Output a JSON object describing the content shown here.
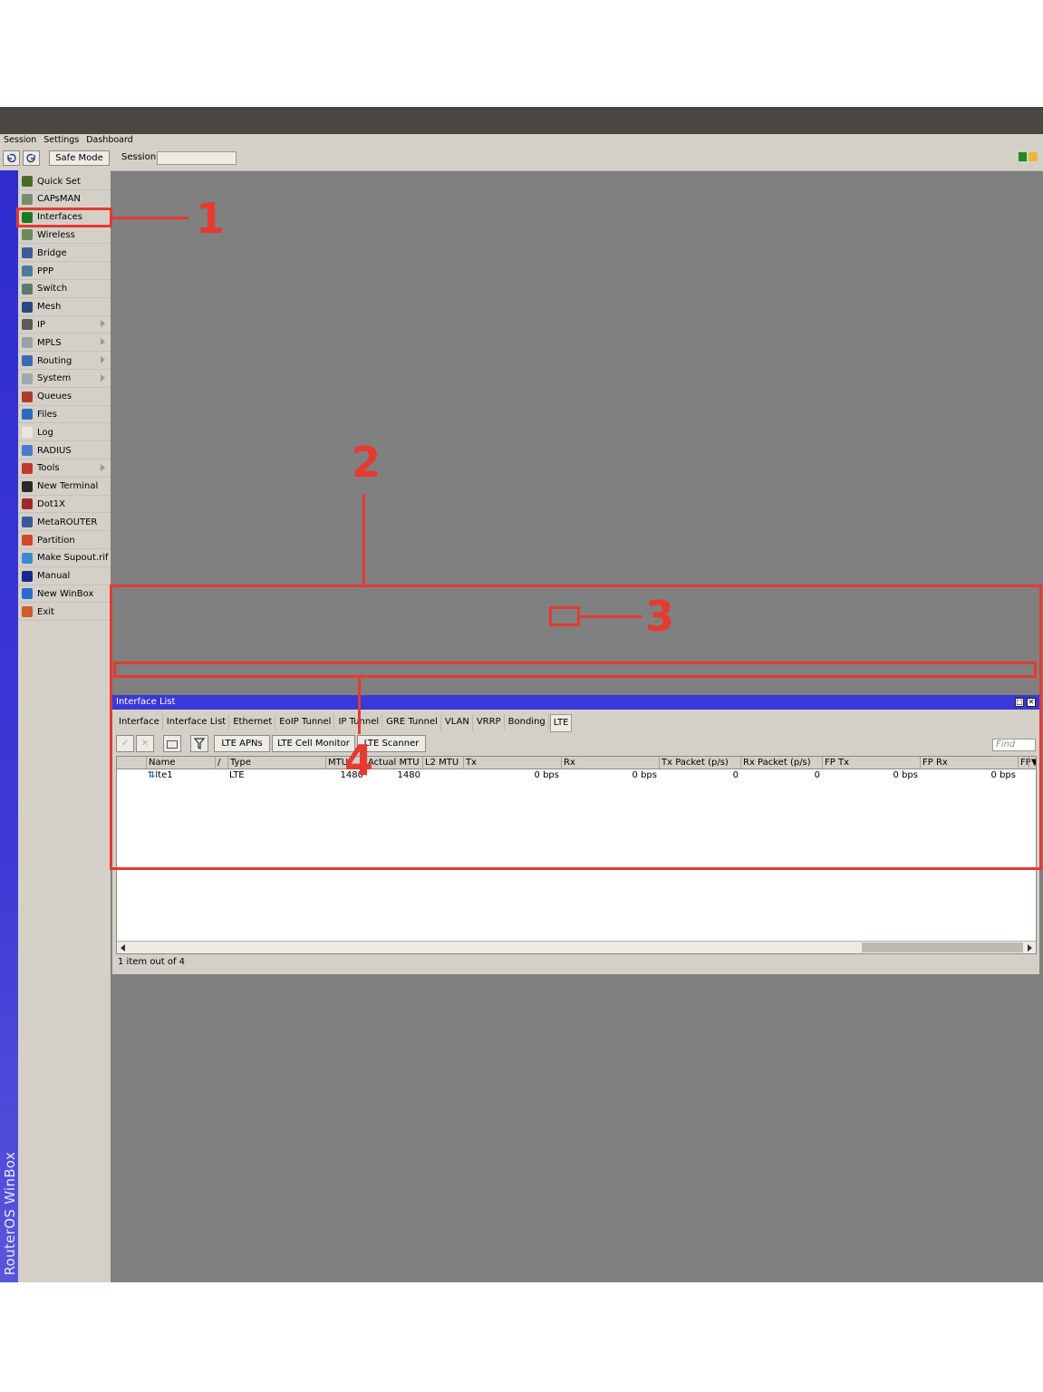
{
  "menu": {
    "items": [
      "Session",
      "Settings",
      "Dashboard"
    ]
  },
  "toolbar": {
    "undo_icon": "undo-icon",
    "redo_icon": "redo-icon",
    "safe_mode_label": "Safe Mode",
    "session_label": "Session:",
    "session_value": ""
  },
  "sidebar": {
    "brand": "RouterOS WinBox",
    "items": [
      {
        "label": "Quick Set",
        "icon": "wand-icon",
        "color": "#4a6a2a",
        "submenu": false
      },
      {
        "label": "CAPsMAN",
        "icon": "antenna-icon",
        "color": "#7a8a6a",
        "submenu": false
      },
      {
        "label": "Interfaces",
        "icon": "interfaces-icon",
        "color": "#1f7a1f",
        "submenu": false
      },
      {
        "label": "Wireless",
        "icon": "wireless-icon",
        "color": "#6a8a5a",
        "submenu": false
      },
      {
        "label": "Bridge",
        "icon": "bridge-icon",
        "color": "#3a5a9a",
        "submenu": false
      },
      {
        "label": "PPP",
        "icon": "ppp-icon",
        "color": "#4a7aa0",
        "submenu": false
      },
      {
        "label": "Switch",
        "icon": "switch-icon",
        "color": "#5a7a6a",
        "submenu": false
      },
      {
        "label": "Mesh",
        "icon": "mesh-icon",
        "color": "#2a4a7a",
        "submenu": false
      },
      {
        "label": "IP",
        "icon": "ip-icon",
        "color": "#5a5a5a",
        "submenu": true
      },
      {
        "label": "MPLS",
        "icon": "mpls-icon",
        "color": "#9aa0a8",
        "submenu": true
      },
      {
        "label": "Routing",
        "icon": "routing-icon",
        "color": "#3a6ab0",
        "submenu": true
      },
      {
        "label": "System",
        "icon": "system-icon",
        "color": "#a0a8b0",
        "submenu": true
      },
      {
        "label": "Queues",
        "icon": "queues-icon",
        "color": "#b03a2a",
        "submenu": false
      },
      {
        "label": "Files",
        "icon": "files-icon",
        "color": "#2a6ac0",
        "submenu": false
      },
      {
        "label": "Log",
        "icon": "log-icon",
        "color": "#e8e6de",
        "submenu": false
      },
      {
        "label": "RADIUS",
        "icon": "radius-icon",
        "color": "#4a7ad0",
        "submenu": false
      },
      {
        "label": "Tools",
        "icon": "tools-icon",
        "color": "#c03a2a",
        "submenu": true
      },
      {
        "label": "New Terminal",
        "icon": "terminal-icon",
        "color": "#2a2a2a",
        "submenu": false
      },
      {
        "label": "Dot1X",
        "icon": "dot1x-icon",
        "color": "#a02a2a",
        "submenu": false
      },
      {
        "label": "MetaROUTER",
        "icon": "metarouter-icon",
        "color": "#3a5a9a",
        "submenu": false
      },
      {
        "label": "Partition",
        "icon": "partition-icon",
        "color": "#d04a2a",
        "submenu": false
      },
      {
        "label": "Make Supout.rif",
        "icon": "supout-icon",
        "color": "#3a8ad0",
        "submenu": false
      },
      {
        "label": "Manual",
        "icon": "manual-icon",
        "color": "#1a2a8a",
        "submenu": false
      },
      {
        "label": "New WinBox",
        "icon": "winbox-icon",
        "color": "#2a6ad0",
        "submenu": false
      },
      {
        "label": "Exit",
        "icon": "exit-icon",
        "color": "#d05a2a",
        "submenu": false
      }
    ]
  },
  "window": {
    "title": "Interface List",
    "tabs": [
      "Interface",
      "Interface List",
      "Ethernet",
      "EoIP Tunnel",
      "IP Tunnel",
      "GRE Tunnel",
      "VLAN",
      "VRRP",
      "Bonding",
      "LTE"
    ],
    "active_tab": "LTE",
    "buttons": [
      "LTE APNs",
      "LTE Cell Monitor",
      "LTE Scanner"
    ],
    "find_placeholder": "Find",
    "columns": [
      "Name",
      "/",
      "Type",
      "MTU",
      "Actual MTU",
      "L2 MTU",
      "Tx",
      "Rx",
      "Tx Packet (p/s)",
      "Rx Packet (p/s)",
      "FP Tx",
      "FP Rx",
      "FP"
    ],
    "rows": [
      {
        "name": "lte1",
        "type": "LTE",
        "mtu": "1480",
        "actual_mtu": "1480",
        "l2_mtu": "",
        "tx": "0 bps",
        "rx": "0 bps",
        "tx_packet": "0",
        "rx_packet": "0",
        "fp_tx": "0 bps",
        "fp_rx": "0 bps"
      }
    ],
    "status": "1 item out of 4"
  },
  "annotations": {
    "labels": [
      "1",
      "2",
      "3",
      "4"
    ],
    "color": "#e53a30"
  }
}
